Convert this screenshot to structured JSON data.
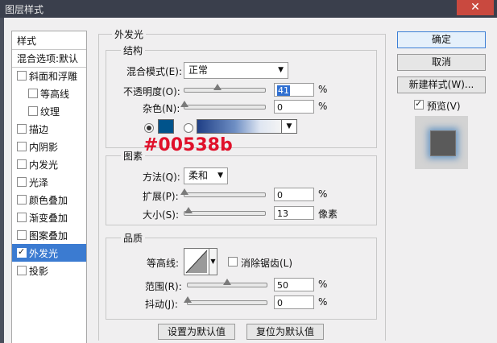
{
  "window": {
    "title": "图层样式",
    "close_glyph": "✕"
  },
  "categories": [
    {
      "label": "样式",
      "has_checkbox": false,
      "checked": false,
      "indent": 0,
      "header": true
    },
    {
      "label": "混合选项:默认",
      "has_checkbox": false,
      "checked": false,
      "indent": 0,
      "header": true
    },
    {
      "label": "斜面和浮雕",
      "has_checkbox": true,
      "checked": false,
      "indent": 0
    },
    {
      "label": "等高线",
      "has_checkbox": true,
      "checked": false,
      "indent": 1
    },
    {
      "label": "纹理",
      "has_checkbox": true,
      "checked": false,
      "indent": 1
    },
    {
      "label": "描边",
      "has_checkbox": true,
      "checked": false,
      "indent": 0
    },
    {
      "label": "内阴影",
      "has_checkbox": true,
      "checked": false,
      "indent": 0
    },
    {
      "label": "内发光",
      "has_checkbox": true,
      "checked": false,
      "indent": 0
    },
    {
      "label": "光泽",
      "has_checkbox": true,
      "checked": false,
      "indent": 0
    },
    {
      "label": "颜色叠加",
      "has_checkbox": true,
      "checked": false,
      "indent": 0
    },
    {
      "label": "渐变叠加",
      "has_checkbox": true,
      "checked": false,
      "indent": 0
    },
    {
      "label": "图案叠加",
      "has_checkbox": true,
      "checked": false,
      "indent": 0
    },
    {
      "label": "外发光",
      "has_checkbox": true,
      "checked": true,
      "indent": 0,
      "selected": true
    },
    {
      "label": "投影",
      "has_checkbox": true,
      "checked": false,
      "indent": 0
    }
  ],
  "outer_glow": {
    "section_title": "外发光",
    "structure": {
      "title": "结构",
      "blend_mode_label": "混合模式(E):",
      "blend_mode_value": "正常",
      "opacity_label": "不透明度(O):",
      "opacity_value": "41",
      "opacity_fraction": 0.41,
      "opacity_unit": "%",
      "noise_label": "杂色(N):",
      "noise_value": "0",
      "noise_fraction": 0,
      "noise_unit": "%",
      "color_hex_annotation": "#00538b",
      "glow_color": "#00538b"
    },
    "elements": {
      "title": "图素",
      "technique_label": "方法(Q):",
      "technique_value": "柔和",
      "spread_label": "扩展(P):",
      "spread_value": "0",
      "spread_fraction": 0,
      "spread_unit": "%",
      "size_label": "大小(S):",
      "size_value": "13",
      "size_fraction": 0.05,
      "size_unit": "像素"
    },
    "quality": {
      "title": "品质",
      "contour_label": "等高线:",
      "antialias_label": "消除锯齿(L)",
      "antialias_checked": false,
      "range_label": "范围(R):",
      "range_value": "50",
      "range_fraction": 0.5,
      "range_unit": "%",
      "jitter_label": "抖动(J):",
      "jitter_value": "0",
      "jitter_fraction": 0,
      "jitter_unit": "%"
    },
    "make_default_label": "设置为默认值",
    "reset_default_label": "复位为默认值"
  },
  "actions": {
    "ok_label": "确定",
    "cancel_label": "取消",
    "new_style_label": "新建样式(W)...",
    "preview_label": "预览(V)",
    "preview_checked": true
  },
  "colors": {
    "accent": "#3b7bd1",
    "annotation": "#e0102a"
  },
  "icons": {
    "close": "close-icon",
    "dropdown": "chevron-down-icon",
    "contour": "contour-curve-icon"
  }
}
